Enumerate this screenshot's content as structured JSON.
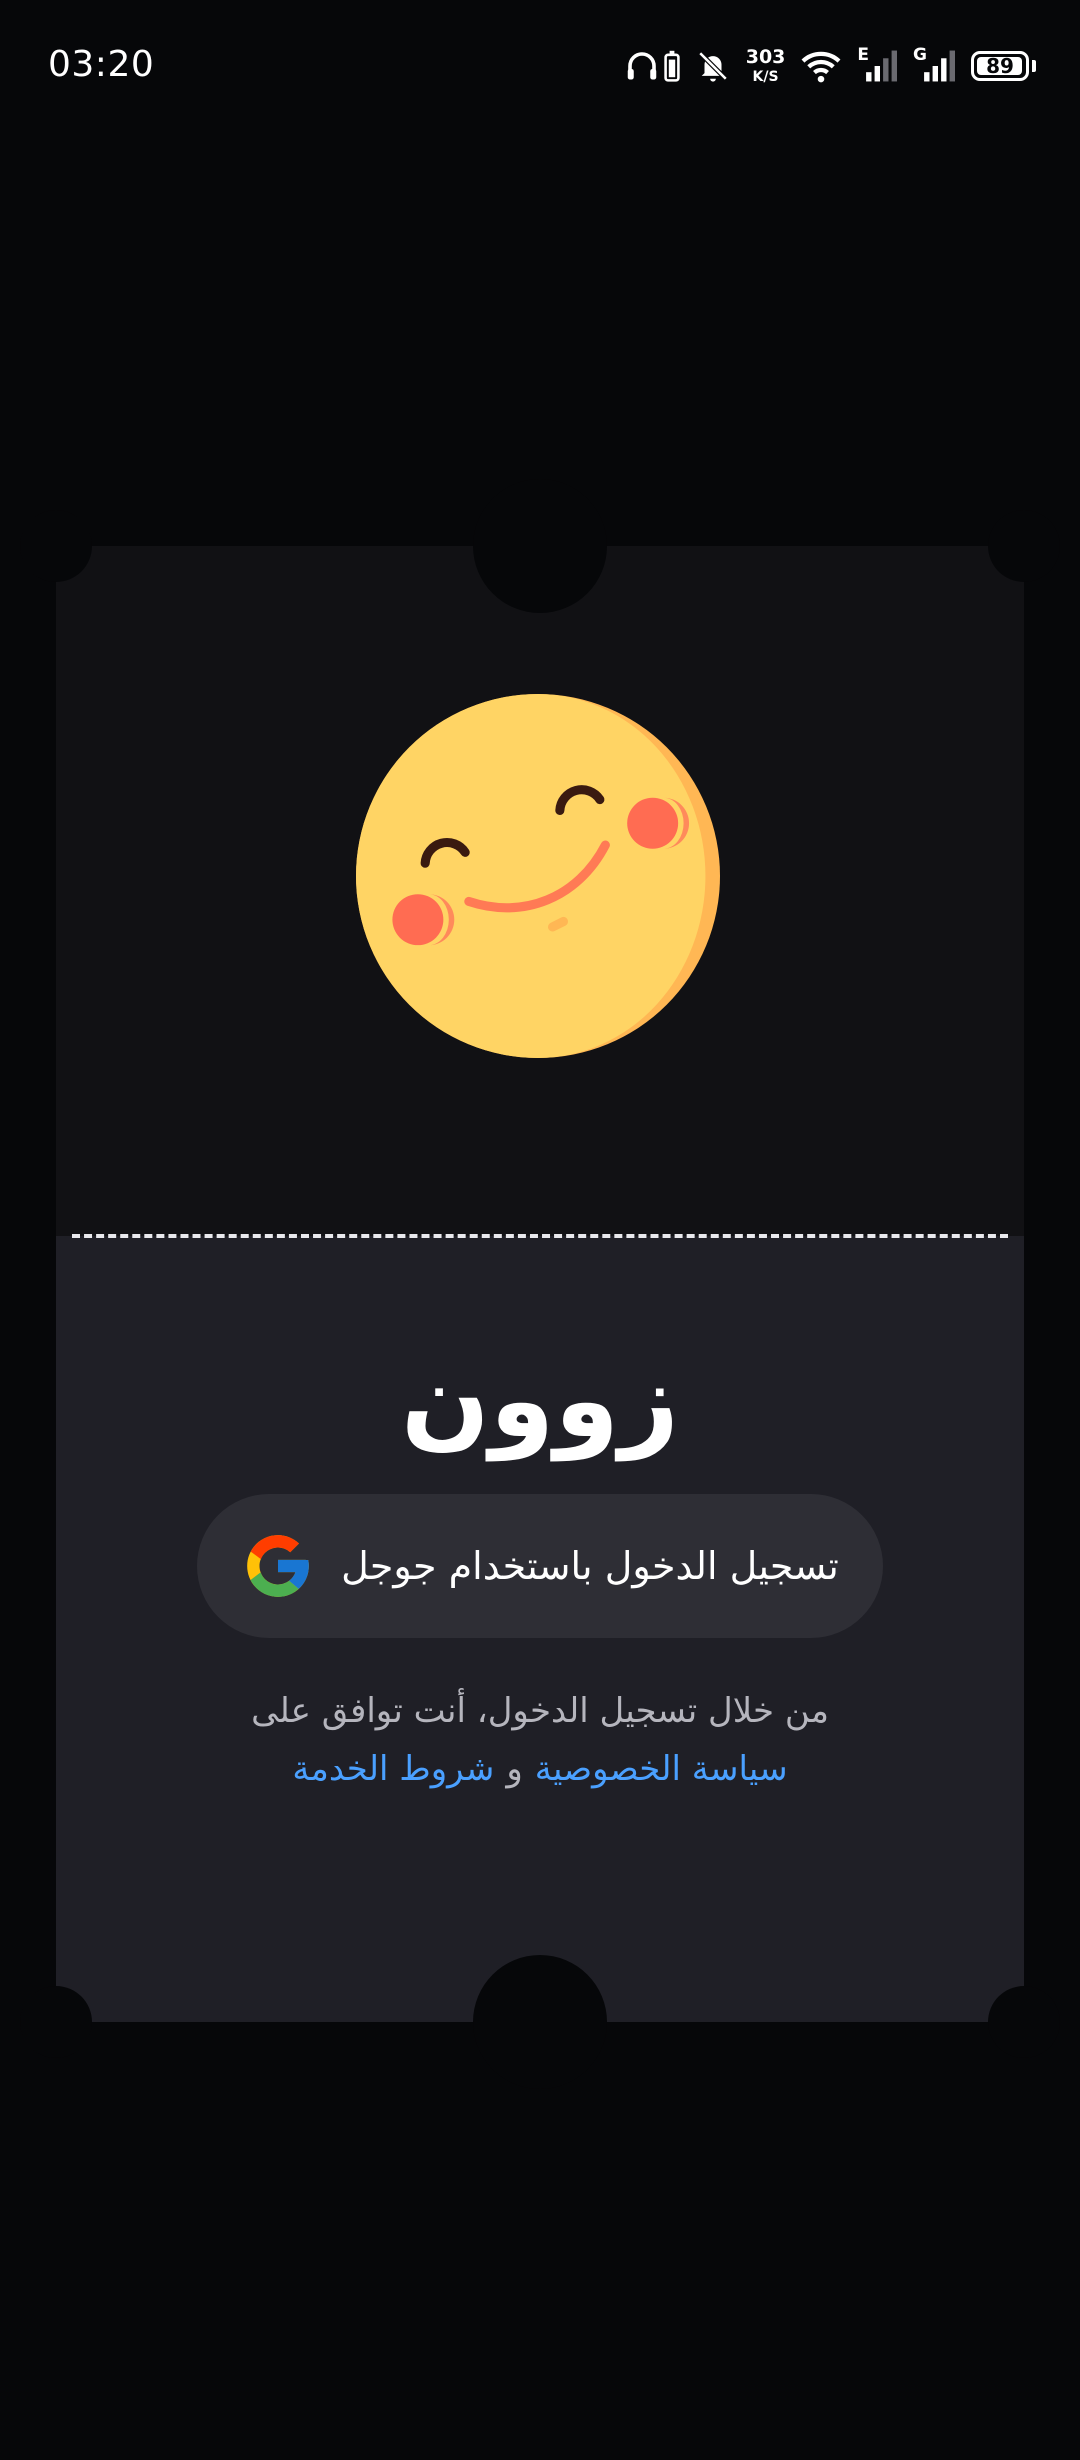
{
  "status_bar": {
    "time": "03:20",
    "net_speed_value": "303",
    "net_speed_unit": "K/S",
    "signal1_label": "E",
    "signal2_label": "G",
    "battery_percent": "89",
    "icons": [
      "headphones-icon",
      "battery-saver-icon",
      "mute-bell-icon",
      "wifi-icon",
      "signal-icon",
      "signal-icon",
      "battery-icon"
    ]
  },
  "app": {
    "name": "زوون",
    "mascot": "smiling-face-icon"
  },
  "login": {
    "google_button_label": "تسجيل الدخول باستخدام جوجل",
    "terms_prefix": "من خلال تسجيل الدخول، أنت توافق على",
    "privacy_link": "سياسة الخصوصية",
    "conjunction": "و",
    "terms_link": "شروط الخدمة"
  },
  "colors": {
    "background": "#060709",
    "ticket_top": "#111114",
    "ticket_bottom": "#1f1f26",
    "button": "#2e2e35",
    "link": "#4aa0ff"
  }
}
